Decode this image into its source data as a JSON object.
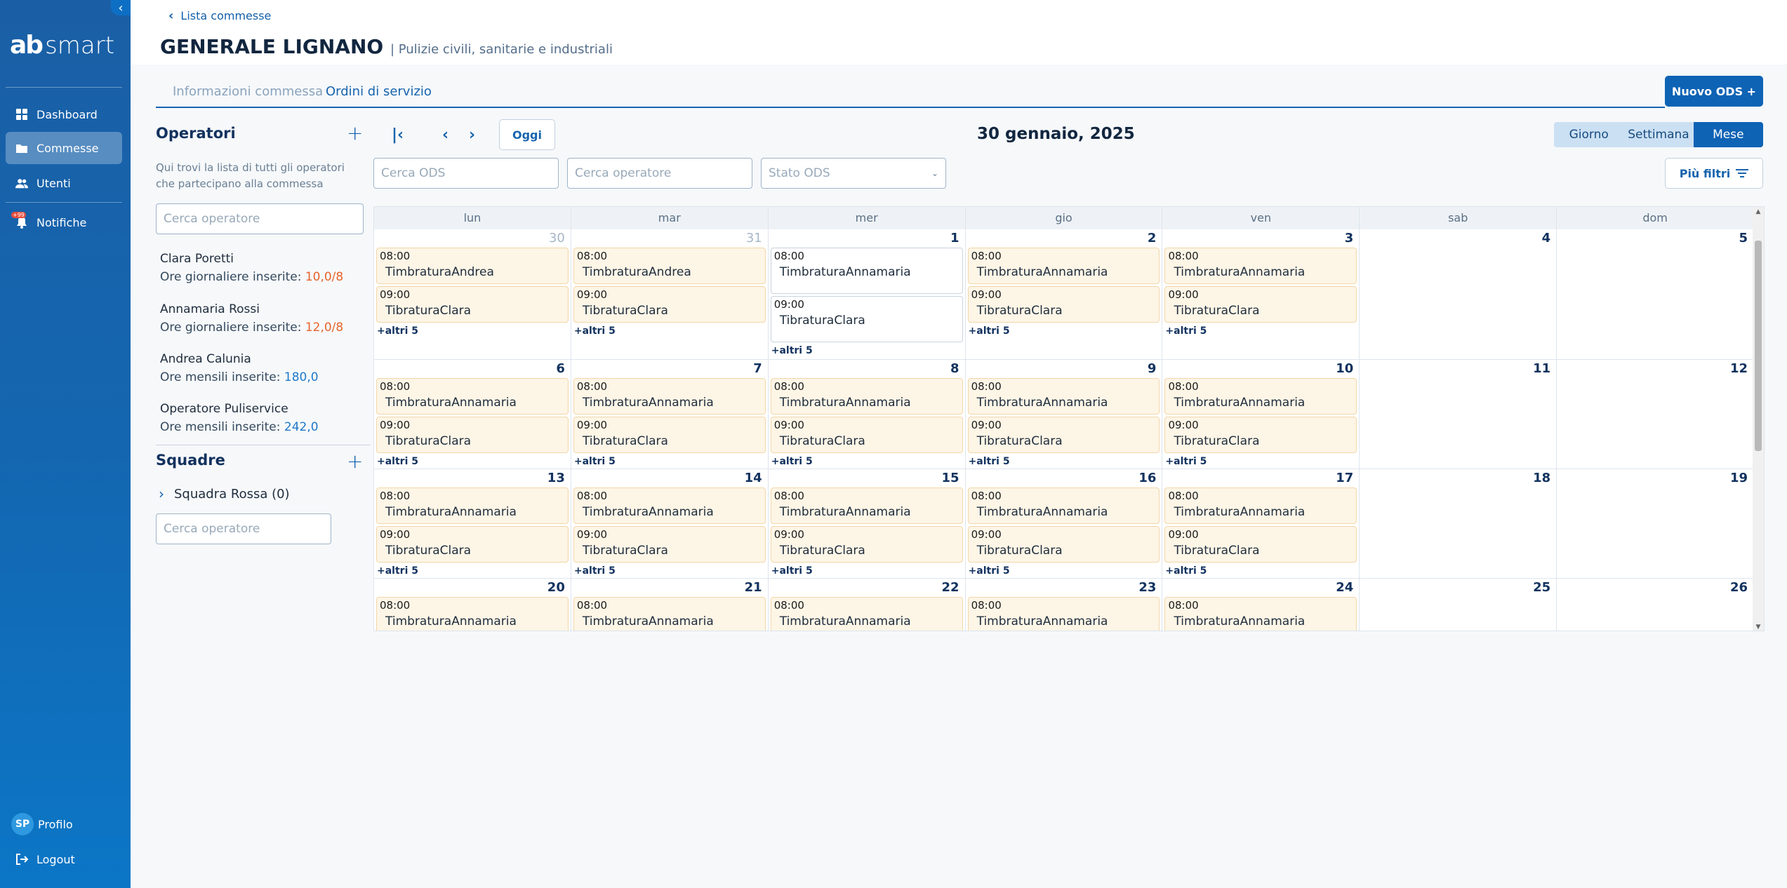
{
  "sidebar": {
    "logo_mark": "ab",
    "logo_text": "smart",
    "items": [
      {
        "label": "Dashboard"
      },
      {
        "label": "Commesse"
      },
      {
        "label": "Utenti"
      },
      {
        "label": "Notifiche",
        "badge": "+99"
      }
    ],
    "profile": {
      "initials": "SP",
      "label": "Profilo"
    },
    "logout": "Logout"
  },
  "header": {
    "back_label": "Lista commesse",
    "title": "GENERALE LIGNANO",
    "subtitle": "| Pulizie civili, sanitarie e industriali"
  },
  "tabs": [
    {
      "label": "Informazioni commessa"
    },
    {
      "label": "Ordini di servizio"
    }
  ],
  "new_ods_label": "Nuovo ODS +",
  "operators": {
    "title": "Operatori",
    "add": "+",
    "description": "Qui trovi la lista di tutti gli operatori  che partecipano alla commessa",
    "search_placeholder": "Cerca operatore",
    "list": [
      {
        "name": "Clara Poretti",
        "hours_label": "Ore giornaliere inserite:",
        "hours": "10,0/8"
      },
      {
        "name": "Annamaria Rossi",
        "hours_label": "Ore giornaliere inserite:",
        "hours": "12,0/8"
      },
      {
        "name": "Andrea Calunia",
        "hours_label": "Ore mensili inserite:",
        "hours": "180,0"
      },
      {
        "name": "Operatore Puliservice",
        "hours_label": "Ore mensili inserite:",
        "hours": "242,0"
      }
    ]
  },
  "teams": {
    "title": "Squadre",
    "add": "+",
    "item": "Squadra Rossa (0)",
    "search_placeholder": "Cerca operatore"
  },
  "calendar": {
    "today_label": "Oggi",
    "title": "30 gennaio, 2025",
    "views": [
      "Giorno",
      "Settimana",
      "Mese"
    ],
    "active_view": "Mese",
    "search_ods_placeholder": "Cerca ODS",
    "search_operator_placeholder": "Cerca operatore",
    "status_placeholder": "Stato ODS",
    "more_filters": "Più filtri",
    "weekdays": [
      "lun",
      "mar",
      "mer",
      "gio",
      "ven",
      "sab",
      "dom"
    ],
    "more_label": "+altri 5",
    "weeks": [
      [
        {
          "num": "30",
          "muted": true,
          "events": [
            {
              "time": "08:00",
              "title": "TimbraturaAndrea"
            },
            {
              "time": "09:00",
              "title": "TibraturaClara"
            }
          ]
        },
        {
          "num": "31",
          "muted": true,
          "events": [
            {
              "time": "08:00",
              "title": "TimbraturaAndrea"
            },
            {
              "time": "09:00",
              "title": "TibraturaClara"
            }
          ]
        },
        {
          "num": "1",
          "plain": true,
          "events": [
            {
              "time": "08:00",
              "title": "TimbraturaAnnamaria"
            },
            {
              "time": "09:00",
              "title": "TibraturaClara"
            }
          ]
        },
        {
          "num": "2",
          "events": [
            {
              "time": "08:00",
              "title": "TimbraturaAnnamaria"
            },
            {
              "time": "09:00",
              "title": "TibraturaClara"
            }
          ]
        },
        {
          "num": "3",
          "events": [
            {
              "time": "08:00",
              "title": "TimbraturaAnnamaria"
            },
            {
              "time": "09:00",
              "title": "TibraturaClara"
            }
          ]
        },
        {
          "num": "4",
          "events": []
        },
        {
          "num": "5",
          "events": []
        }
      ],
      [
        {
          "num": "6",
          "events": [
            {
              "time": "08:00",
              "title": "TimbraturaAnnamaria"
            },
            {
              "time": "09:00",
              "title": "TibraturaClara"
            }
          ]
        },
        {
          "num": "7",
          "events": [
            {
              "time": "08:00",
              "title": "TimbraturaAnnamaria"
            },
            {
              "time": "09:00",
              "title": "TibraturaClara"
            }
          ]
        },
        {
          "num": "8",
          "events": [
            {
              "time": "08:00",
              "title": "TimbraturaAnnamaria"
            },
            {
              "time": "09:00",
              "title": "TibraturaClara"
            }
          ]
        },
        {
          "num": "9",
          "events": [
            {
              "time": "08:00",
              "title": "TimbraturaAnnamaria"
            },
            {
              "time": "09:00",
              "title": "TibraturaClara"
            }
          ]
        },
        {
          "num": "10",
          "events": [
            {
              "time": "08:00",
              "title": "TimbraturaAnnamaria"
            },
            {
              "time": "09:00",
              "title": "TibraturaClara"
            }
          ]
        },
        {
          "num": "11",
          "events": []
        },
        {
          "num": "12",
          "events": []
        }
      ],
      [
        {
          "num": "13",
          "events": [
            {
              "time": "08:00",
              "title": "TimbraturaAnnamaria"
            },
            {
              "time": "09:00",
              "title": "TibraturaClara"
            }
          ]
        },
        {
          "num": "14",
          "events": [
            {
              "time": "08:00",
              "title": "TimbraturaAnnamaria"
            },
            {
              "time": "09:00",
              "title": "TibraturaClara"
            }
          ]
        },
        {
          "num": "15",
          "events": [
            {
              "time": "08:00",
              "title": "TimbraturaAnnamaria"
            },
            {
              "time": "09:00",
              "title": "TibraturaClara"
            }
          ]
        },
        {
          "num": "16",
          "events": [
            {
              "time": "08:00",
              "title": "TimbraturaAnnamaria"
            },
            {
              "time": "09:00",
              "title": "TibraturaClara"
            }
          ]
        },
        {
          "num": "17",
          "events": [
            {
              "time": "08:00",
              "title": "TimbraturaAnnamaria"
            },
            {
              "time": "09:00",
              "title": "TibraturaClara"
            }
          ]
        },
        {
          "num": "18",
          "events": []
        },
        {
          "num": "19",
          "events": []
        }
      ],
      [
        {
          "num": "20",
          "events": [
            {
              "time": "08:00",
              "title": "TimbraturaAnnamaria"
            }
          ]
        },
        {
          "num": "21",
          "events": [
            {
              "time": "08:00",
              "title": "TimbraturaAnnamaria"
            }
          ]
        },
        {
          "num": "22",
          "events": [
            {
              "time": "08:00",
              "title": "TimbraturaAnnamaria"
            }
          ]
        },
        {
          "num": "23",
          "events": [
            {
              "time": "08:00",
              "title": "TimbraturaAnnamaria"
            }
          ]
        },
        {
          "num": "24",
          "events": [
            {
              "time": "08:00",
              "title": "TimbraturaAnnamaria"
            }
          ]
        },
        {
          "num": "25",
          "events": []
        },
        {
          "num": "26",
          "events": []
        }
      ]
    ]
  },
  "colors": {
    "primary": "#0e63b5",
    "sidebar": "#1466b0",
    "event_bg": "#fdf5e6",
    "warning_hours": "#e8632b",
    "ok_hours": "#1f78c8"
  }
}
